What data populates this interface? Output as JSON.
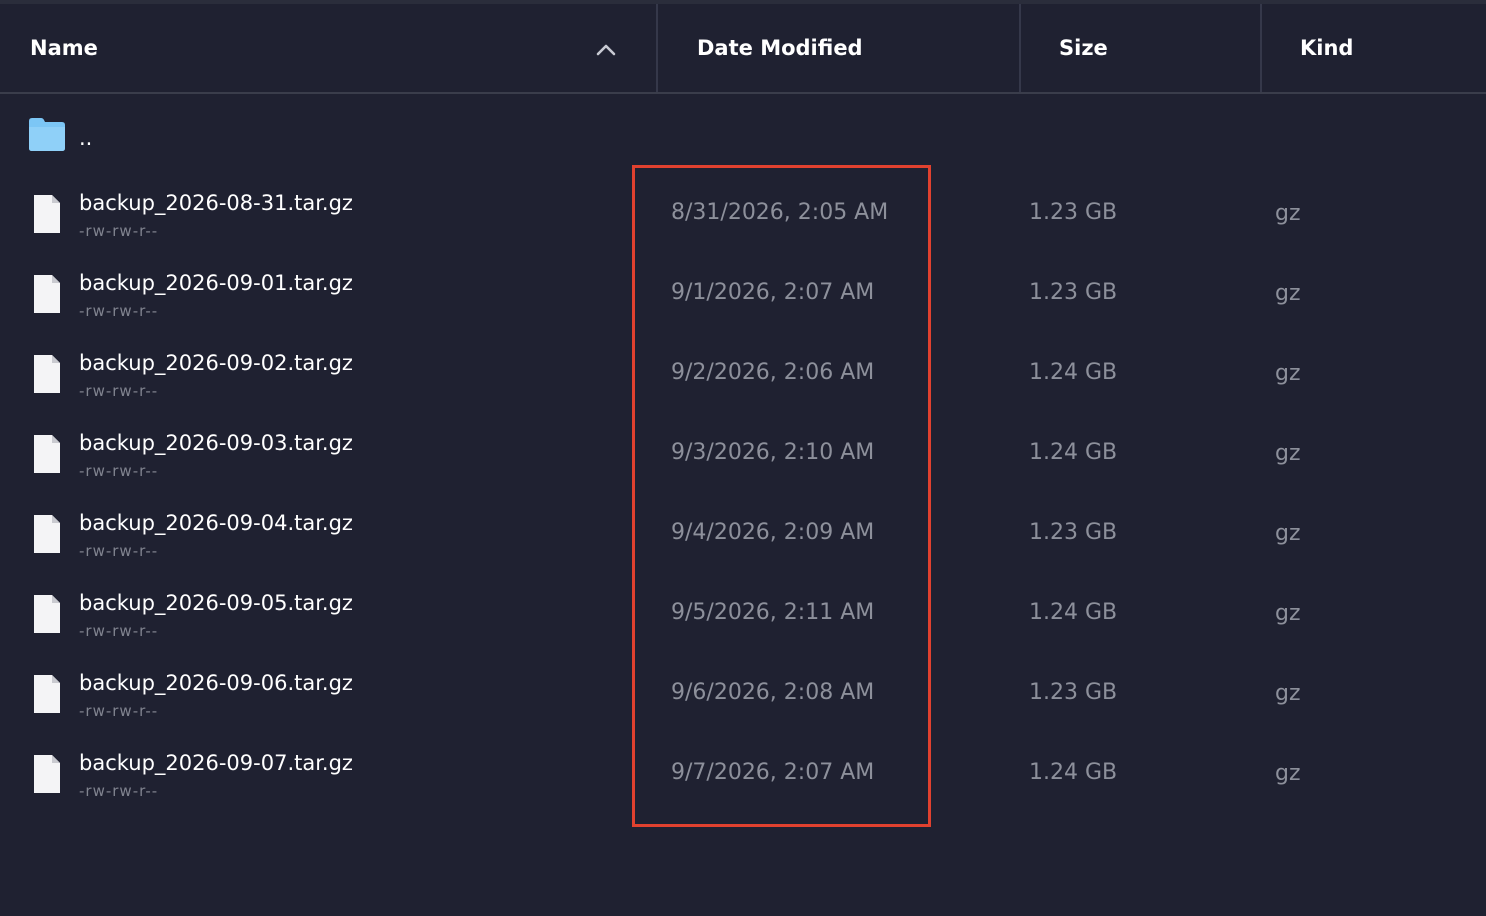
{
  "columns": {
    "name": "Name",
    "date_modified": "Date Modified",
    "size": "Size",
    "kind": "Kind"
  },
  "sort": {
    "column": "name",
    "direction": "ascending",
    "icon": "chevron-up-icon"
  },
  "parent_entry": {
    "name": "..",
    "icon": "folder-icon"
  },
  "files": [
    {
      "name": "backup_2026-08-31.tar.gz",
      "permissions": "-rw-rw-r--",
      "date": "8/31/2026, 2:05 AM",
      "size": "1.23 GB",
      "kind": "gz"
    },
    {
      "name": "backup_2026-09-01.tar.gz",
      "permissions": "-rw-rw-r--",
      "date": "9/1/2026, 2:07 AM",
      "size": "1.23 GB",
      "kind": "gz"
    },
    {
      "name": "backup_2026-09-02.tar.gz",
      "permissions": "-rw-rw-r--",
      "date": "9/2/2026, 2:06 AM",
      "size": "1.24 GB",
      "kind": "gz"
    },
    {
      "name": "backup_2026-09-03.tar.gz",
      "permissions": "-rw-rw-r--",
      "date": "9/3/2026, 2:10 AM",
      "size": "1.24 GB",
      "kind": "gz"
    },
    {
      "name": "backup_2026-09-04.tar.gz",
      "permissions": "-rw-rw-r--",
      "date": "9/4/2026, 2:09 AM",
      "size": "1.23 GB",
      "kind": "gz"
    },
    {
      "name": "backup_2026-09-05.tar.gz",
      "permissions": "-rw-rw-r--",
      "date": "9/5/2026, 2:11 AM",
      "size": "1.24 GB",
      "kind": "gz"
    },
    {
      "name": "backup_2026-09-06.tar.gz",
      "permissions": "-rw-rw-r--",
      "date": "9/6/2026, 2:08 AM",
      "size": "1.23 GB",
      "kind": "gz"
    },
    {
      "name": "backup_2026-09-07.tar.gz",
      "permissions": "-rw-rw-r--",
      "date": "9/7/2026, 2:07 AM",
      "size": "1.24 GB",
      "kind": "gz"
    }
  ],
  "colors": {
    "background": "#1f2131",
    "header_text": "#ffffff",
    "secondary_text": "#8d909b",
    "folder_icon": "#7cc6f5",
    "highlight_border": "#e0412f"
  }
}
